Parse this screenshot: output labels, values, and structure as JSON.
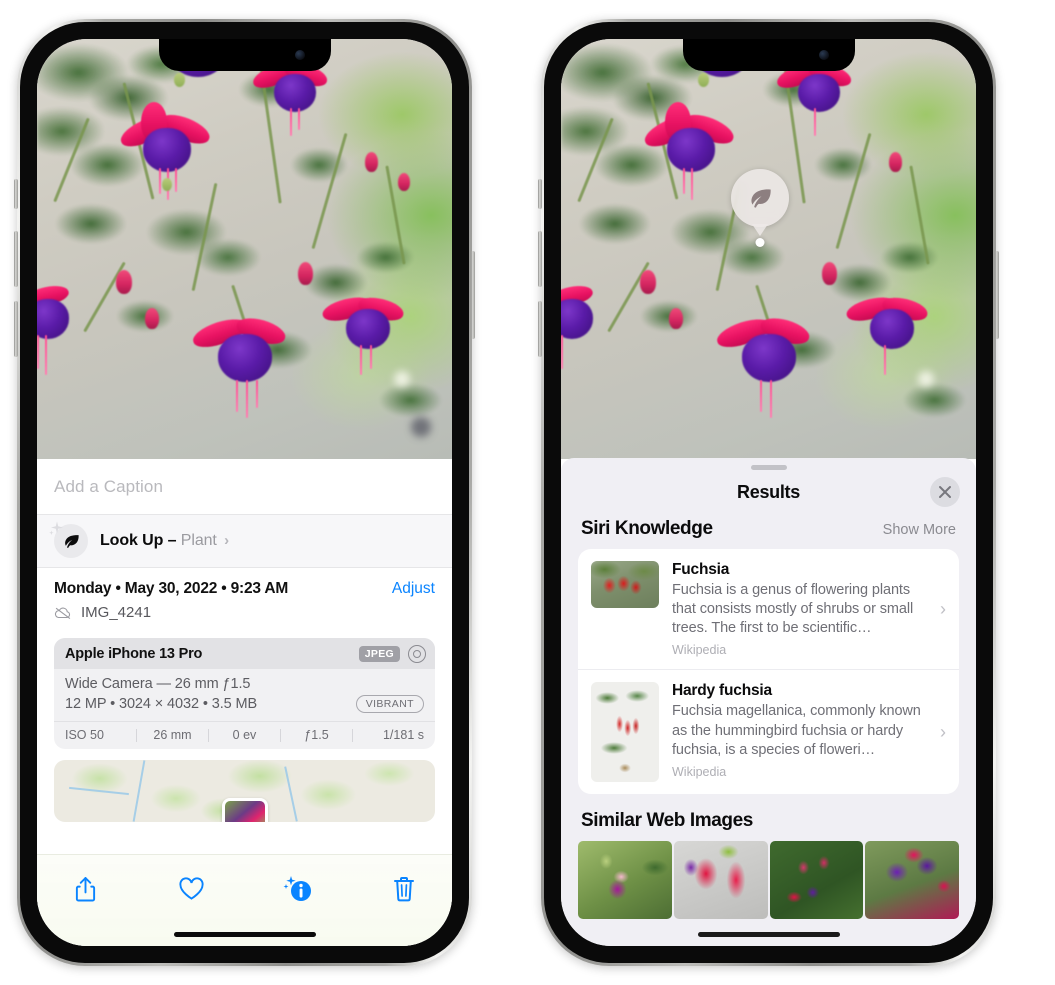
{
  "left_phone": {
    "caption_placeholder": "Add a Caption",
    "lookup": {
      "label": "Look Up –",
      "subject": "Plant",
      "chevron": "›",
      "icon": "leaf-icon"
    },
    "meta": {
      "date": "Monday • May 30, 2022 • 9:23 AM",
      "adjust": "Adjust",
      "filename": "IMG_4241",
      "cloud_icon": "icloud-slash-icon"
    },
    "camera": {
      "model": "Apple iPhone 13 Pro",
      "format_badge": "JPEG",
      "raw_icon": "raw-aperture-icon",
      "lens": "Wide Camera — 26 mm ƒ1.5",
      "specs": "12 MP • 3024 × 4032 • 3.5 MB",
      "style_badge": "VIBRANT",
      "exif": [
        "ISO 50",
        "26 mm",
        "0 ev",
        "ƒ1.5",
        "1/181 s"
      ]
    },
    "toolbar": [
      {
        "name": "share-button",
        "icon": "share-icon"
      },
      {
        "name": "favorite-button",
        "icon": "heart-icon"
      },
      {
        "name": "info-button",
        "icon": "info-sparkle-icon"
      },
      {
        "name": "delete-button",
        "icon": "trash-icon"
      }
    ],
    "accent_color": "#0a84ff"
  },
  "right_phone": {
    "leaf_badge_icon": "leaf-icon",
    "sheet": {
      "title": "Results",
      "close_icon": "close-icon",
      "siri_knowledge": {
        "title": "Siri Knowledge",
        "show_more": "Show More",
        "items": [
          {
            "title": "Fuchsia",
            "description": "Fuchsia is a genus of flowering plants that consists mostly of shrubs or small trees. The first to be scientific…",
            "source": "Wikipedia",
            "chevron": "›"
          },
          {
            "title": "Hardy fuchsia",
            "description": "Fuchsia magellanica, commonly known as the hummingbird fuchsia or hardy fuchsia, is a species of floweri…",
            "source": "Wikipedia",
            "chevron": "›"
          }
        ]
      },
      "similar_web_images": {
        "title": "Similar Web Images",
        "count": 4
      }
    }
  }
}
